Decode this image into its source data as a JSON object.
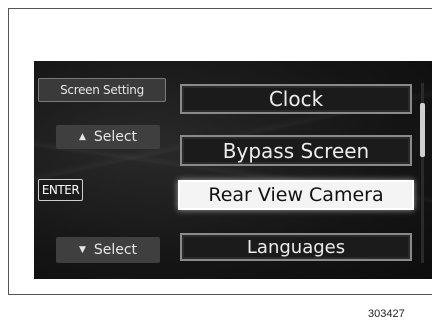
{
  "left_buttons": {
    "screen_setting": "Screen Setting",
    "select_up": "Select",
    "enter": "ENTER",
    "select_down": "Select"
  },
  "menu": {
    "items": [
      {
        "label": "Clock",
        "selected": false
      },
      {
        "label": "Bypass Screen",
        "selected": false
      },
      {
        "label": "Rear View Camera",
        "selected": true
      },
      {
        "label": "Languages",
        "selected": false
      }
    ]
  },
  "icons": {
    "up": "triangle-up-icon",
    "down": "triangle-down-icon"
  },
  "colors": {
    "screen_bg": "#141414",
    "highlight_bg": "#f4f4f4",
    "item_border": "#8a8a8a"
  },
  "figure_number": "303427"
}
